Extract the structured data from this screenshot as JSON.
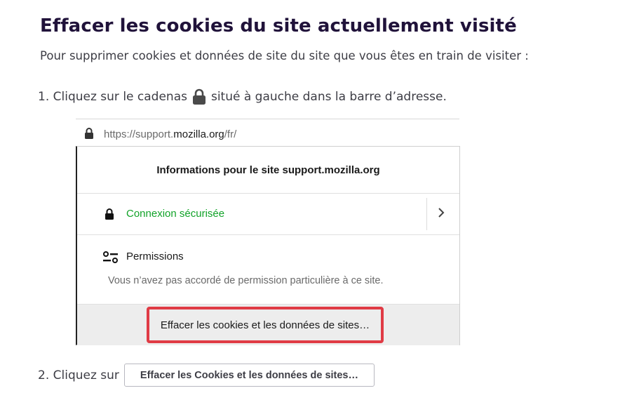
{
  "heading": "Effacer les cookies du site actuellement visité",
  "intro": "Pour supprimer cookies et données de site du site que vous êtes en train de visiter :",
  "step1": {
    "before": "1. Cliquez sur le cadenas",
    "after": "situé à gauche dans la barre d’adresse.",
    "icon": "lock-icon"
  },
  "browser": {
    "url_prefix": "https://support.",
    "url_domain": "mozilla.org",
    "url_suffix": "/fr/",
    "panel_title": "Informations pour le site support.mozilla.org",
    "connection_label": "Connexion sécurisée",
    "permissions_title": "Permissions",
    "permissions_desc": "Vous n’avez pas accordé de permission particulière à ce site.",
    "clear_button": "Effacer les cookies et les données de sites…",
    "colors": {
      "secure_green": "#12a329",
      "highlight_red": "#e03b45"
    }
  },
  "step2": {
    "before": "2. Cliquez sur",
    "button_label": "Effacer les Cookies et les données de sites…"
  }
}
